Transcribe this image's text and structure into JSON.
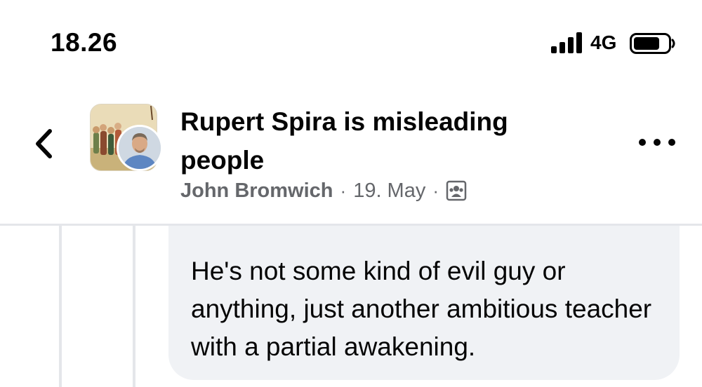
{
  "status_bar": {
    "time": "18.26",
    "network": "4G",
    "signal_bars": 4,
    "battery_icon": "battery-icon"
  },
  "header": {
    "back_icon": "chevron-left-icon",
    "title": "Rupert Spira is misleading people",
    "author": "John Bromwich",
    "separator": "·",
    "date": "19. May",
    "audience_icon": "group-members-icon",
    "more_icon": "more-horizontal-icon"
  },
  "comment": {
    "text": "He's not some kind of evil guy or anything, just another ambitious teacher with a partial awakening."
  },
  "colors": {
    "bubble_bg": "#f0f2f5",
    "meta_text": "#65676b",
    "primary_text": "#050505",
    "thread_line": "#e4e6ea"
  }
}
